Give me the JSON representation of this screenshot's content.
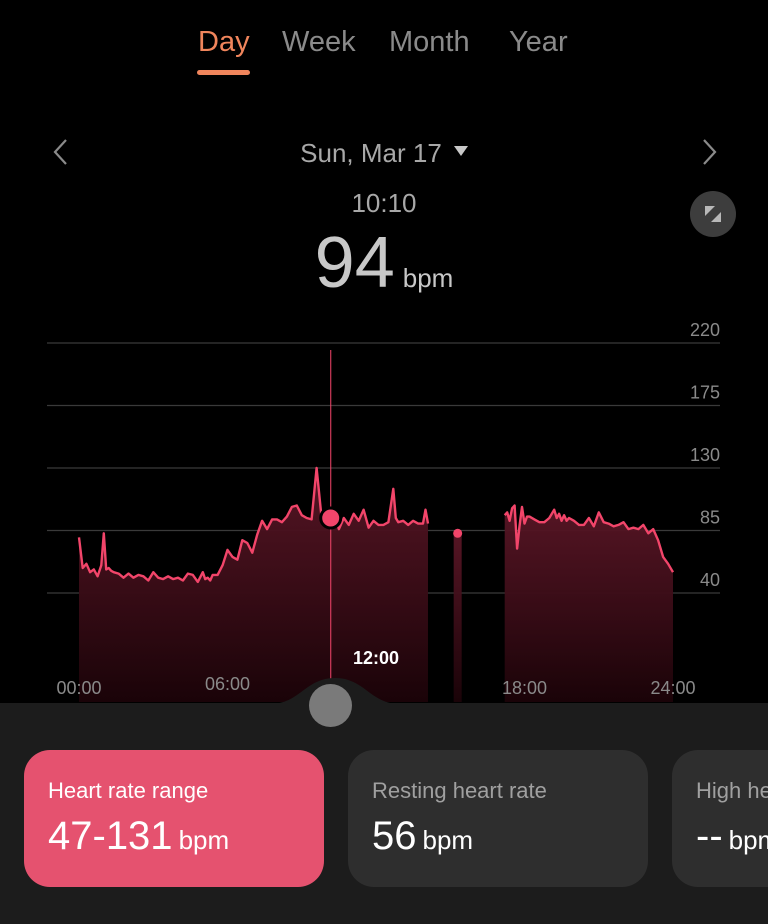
{
  "tabs": [
    {
      "label": "Day",
      "active": true
    },
    {
      "label": "Week",
      "active": false
    },
    {
      "label": "Month",
      "active": false
    },
    {
      "label": "Year",
      "active": false
    }
  ],
  "date_selector": {
    "label": "Sun, Mar 17"
  },
  "selected_reading": {
    "time": "10:10",
    "value": "94",
    "unit": "bpm"
  },
  "colors": {
    "accent": "#f0855c",
    "heart": "#f2456a",
    "card_active": "#e5526f",
    "card": "#2e2e2e"
  },
  "chart_data": {
    "type": "area",
    "title": "",
    "xlabel": "",
    "ylabel": "bpm",
    "x_unit": "hours",
    "xlim": [
      0,
      24
    ],
    "ylim": [
      0,
      220
    ],
    "y_ticks": [
      40,
      85,
      130,
      175,
      220
    ],
    "x_tick_labels": [
      "00:00",
      "06:00",
      "12:00",
      "18:00",
      "24:00"
    ],
    "x_tick_hours": [
      0,
      6,
      12,
      18,
      24
    ],
    "highlighted_x_label": "12:00",
    "grid": true,
    "selected_point": {
      "x": 10.17,
      "y": 94
    },
    "segments": [
      {
        "x": [
          0,
          0.15,
          0.3,
          0.45,
          0.6,
          0.75,
          0.9,
          1.0,
          1.1,
          1.2,
          1.3,
          1.4,
          1.6,
          1.8,
          2.0,
          2.2,
          2.4,
          2.6,
          2.8,
          3.0,
          3.2,
          3.4,
          3.6,
          3.8,
          4.0,
          4.2,
          4.4,
          4.6,
          4.8,
          5.0,
          5.1,
          5.2,
          5.3,
          5.4,
          5.6,
          5.8,
          6.0,
          6.2,
          6.4,
          6.6,
          6.8,
          7.0,
          7.2,
          7.4,
          7.6,
          7.8,
          8.0,
          8.2,
          8.4,
          8.6,
          8.8,
          9.0,
          9.2,
          9.4,
          9.6,
          9.8,
          10.0,
          10.1,
          10.17,
          10.3,
          10.5,
          10.7,
          10.9,
          11.1,
          11.3,
          11.5,
          11.7,
          11.9,
          12.1,
          12.3,
          12.5,
          12.7,
          12.8,
          12.9,
          13.1,
          13.3,
          13.5,
          13.7,
          13.9,
          14.0,
          14.1
        ],
        "y": [
          80,
          58,
          61,
          55,
          57,
          52,
          60,
          83,
          57,
          58,
          56,
          55,
          54,
          51,
          54,
          51,
          53,
          52,
          49,
          55,
          51,
          50,
          52,
          50,
          51,
          49,
          54,
          53,
          48,
          55,
          50,
          51,
          49,
          53,
          53,
          60,
          71,
          66,
          64,
          78,
          76,
          69,
          82,
          92,
          86,
          93,
          93,
          91,
          95,
          102,
          103,
          96,
          94,
          93,
          130,
          94,
          94,
          92,
          94,
          97,
          86,
          94,
          89,
          97,
          92,
          100,
          87,
          92,
          89,
          89,
          91,
          115,
          94,
          91,
          92,
          89,
          92,
          90,
          90,
          100,
          90
        ]
      },
      {
        "x": [
          15.3,
          15.3
        ],
        "y": [
          83,
          83
        ]
      },
      {
        "x": [
          17.2,
          17.3,
          17.4,
          17.5,
          17.6,
          17.7,
          17.8,
          17.9,
          18.0,
          18.1,
          18.2,
          18.4,
          18.6,
          18.8,
          19.0,
          19.2,
          19.3,
          19.4,
          19.5,
          19.6,
          19.7,
          19.8,
          20.0,
          20.2,
          20.4,
          20.6,
          20.8,
          21.0,
          21.2,
          21.4,
          21.6,
          21.8,
          22.0,
          22.2,
          22.4,
          22.6,
          22.8,
          23.0,
          23.2,
          23.4,
          23.6,
          23.8,
          24.0
        ],
        "y": [
          96,
          98,
          92,
          101,
          103,
          72,
          88,
          102,
          90,
          95,
          95,
          93,
          91,
          91,
          94,
          100,
          94,
          97,
          92,
          96,
          92,
          94,
          92,
          89,
          89,
          94,
          88,
          98,
          91,
          90,
          88,
          89,
          91,
          86,
          87,
          86,
          89,
          83,
          86,
          78,
          66,
          61,
          55
        ]
      }
    ]
  },
  "cards": [
    {
      "label": "Heart rate range",
      "value": "47-131",
      "unit": "bpm",
      "active": true
    },
    {
      "label": "Resting heart rate",
      "value": "56",
      "unit": "bpm",
      "active": false
    },
    {
      "label": "High he",
      "value": "--",
      "unit": "bpm",
      "active": false
    }
  ]
}
